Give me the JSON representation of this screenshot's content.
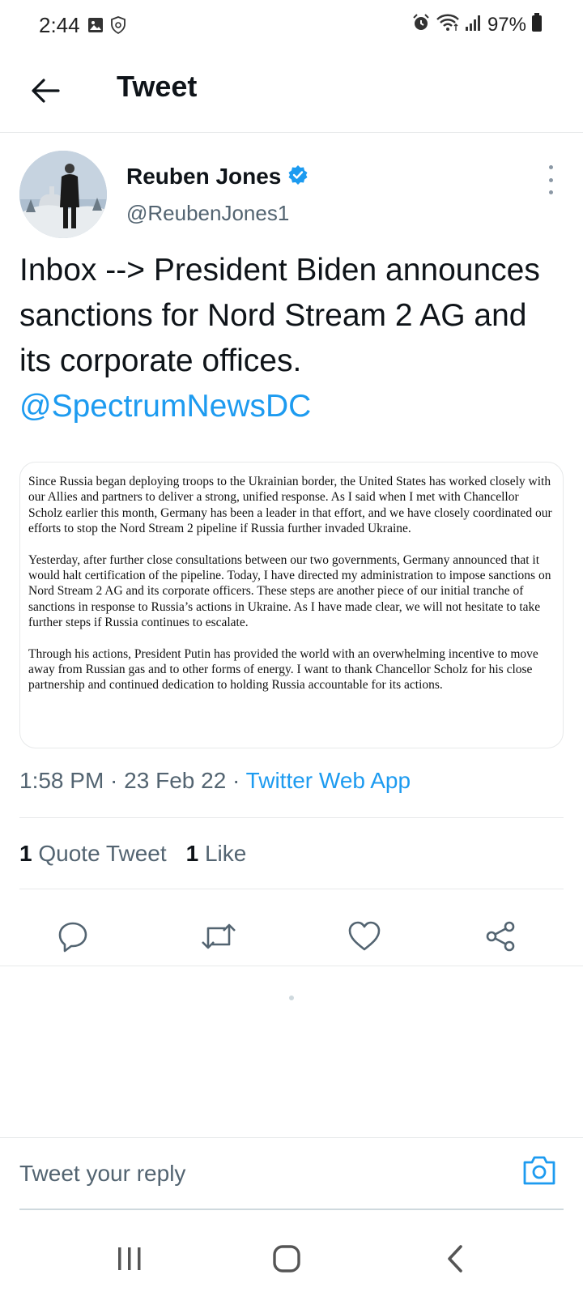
{
  "status_bar": {
    "time": "2:44",
    "battery_percent": "97%",
    "icons_left": [
      "image-icon",
      "shield-icon"
    ],
    "icons_right": [
      "alarm-icon",
      "wifi-icon",
      "signal-icon",
      "battery-icon"
    ]
  },
  "header": {
    "title": "Tweet"
  },
  "tweet": {
    "author_name": "Reuben Jones",
    "author_handle": "@ReubenJones1",
    "verified": true,
    "text_prefix": "Inbox --> President Biden announces sanctions for Nord Stream 2 AG and its corporate offices. ",
    "text_mention": "@SpectrumNewsDC",
    "image_paragraphs": [
      "Since Russia began deploying troops to the Ukrainian border, the United States has worked closely with our Allies and partners to deliver a strong, unified response. As I said when I met with Chancellor Scholz earlier this month, Germany has been a leader in that effort, and we have closely coordinated our efforts to stop the Nord Stream 2 pipeline if Russia further invaded Ukraine.",
      "Yesterday, after further close consultations between our two governments, Germany announced that it would halt certification of the pipeline. Today, I have directed my administration to impose sanctions on Nord Stream 2 AG and its corporate officers. These steps are another piece of our initial tranche of sanctions in response to Russia’s actions in Ukraine. As I have made clear, we will not hesitate to take further steps if Russia continues to escalate.",
      "Through his actions, President Putin has provided the world with an overwhelming incentive to move away from Russian gas and to other forms of energy. I want to thank Chancellor Scholz for his close partnership and continued dedication to holding Russia accountable for its actions."
    ],
    "time": "1:58 PM",
    "date": "23 Feb 22",
    "separator": " · ",
    "source": "Twitter Web App",
    "quote_count": "1",
    "quote_label": "Quote Tweet",
    "like_count": "1",
    "like_label": "Like"
  },
  "actions": [
    "reply-icon",
    "retweet-icon",
    "like-icon",
    "share-icon"
  ],
  "reply": {
    "placeholder": "Tweet your reply"
  },
  "colors": {
    "accent": "#1d9bf0",
    "text": "#0f1419",
    "secondary": "#536471",
    "divider": "#e7e9ea"
  }
}
